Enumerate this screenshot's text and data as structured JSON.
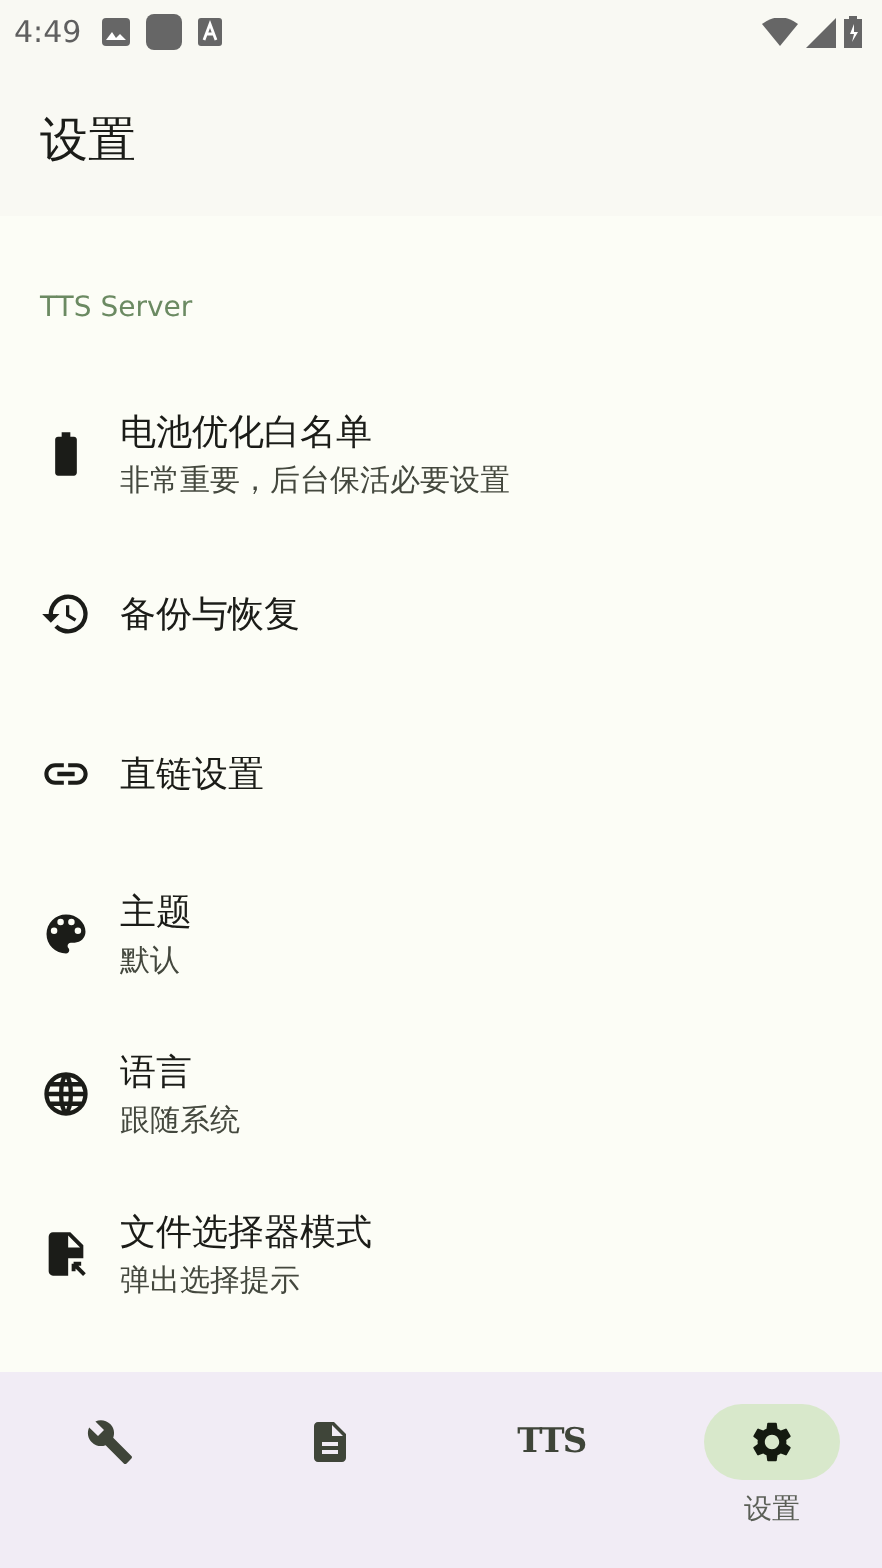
{
  "status_bar": {
    "time": "4:49"
  },
  "top_bar": {
    "title": "设置"
  },
  "section": {
    "title": "TTS Server"
  },
  "items": [
    {
      "kind": "battery",
      "title": "电池优化白名单",
      "subtitle": "非常重要，后台保活必要设置"
    },
    {
      "kind": "restore",
      "title": "备份与恢复"
    },
    {
      "kind": "link",
      "title": "直链设置"
    },
    {
      "kind": "palette",
      "title": "主题",
      "subtitle": "默认"
    },
    {
      "kind": "globe",
      "title": "语言",
      "subtitle": "跟随系统"
    },
    {
      "kind": "file",
      "title": "文件选择器模式",
      "subtitle": "弹出选择提示"
    }
  ],
  "nav": [
    {
      "kind": "wrench",
      "selected": false
    },
    {
      "kind": "document",
      "selected": false
    },
    {
      "kind": "tts",
      "glyph": "TTS",
      "selected": false
    },
    {
      "kind": "gear",
      "label": "设置",
      "selected": true
    }
  ]
}
